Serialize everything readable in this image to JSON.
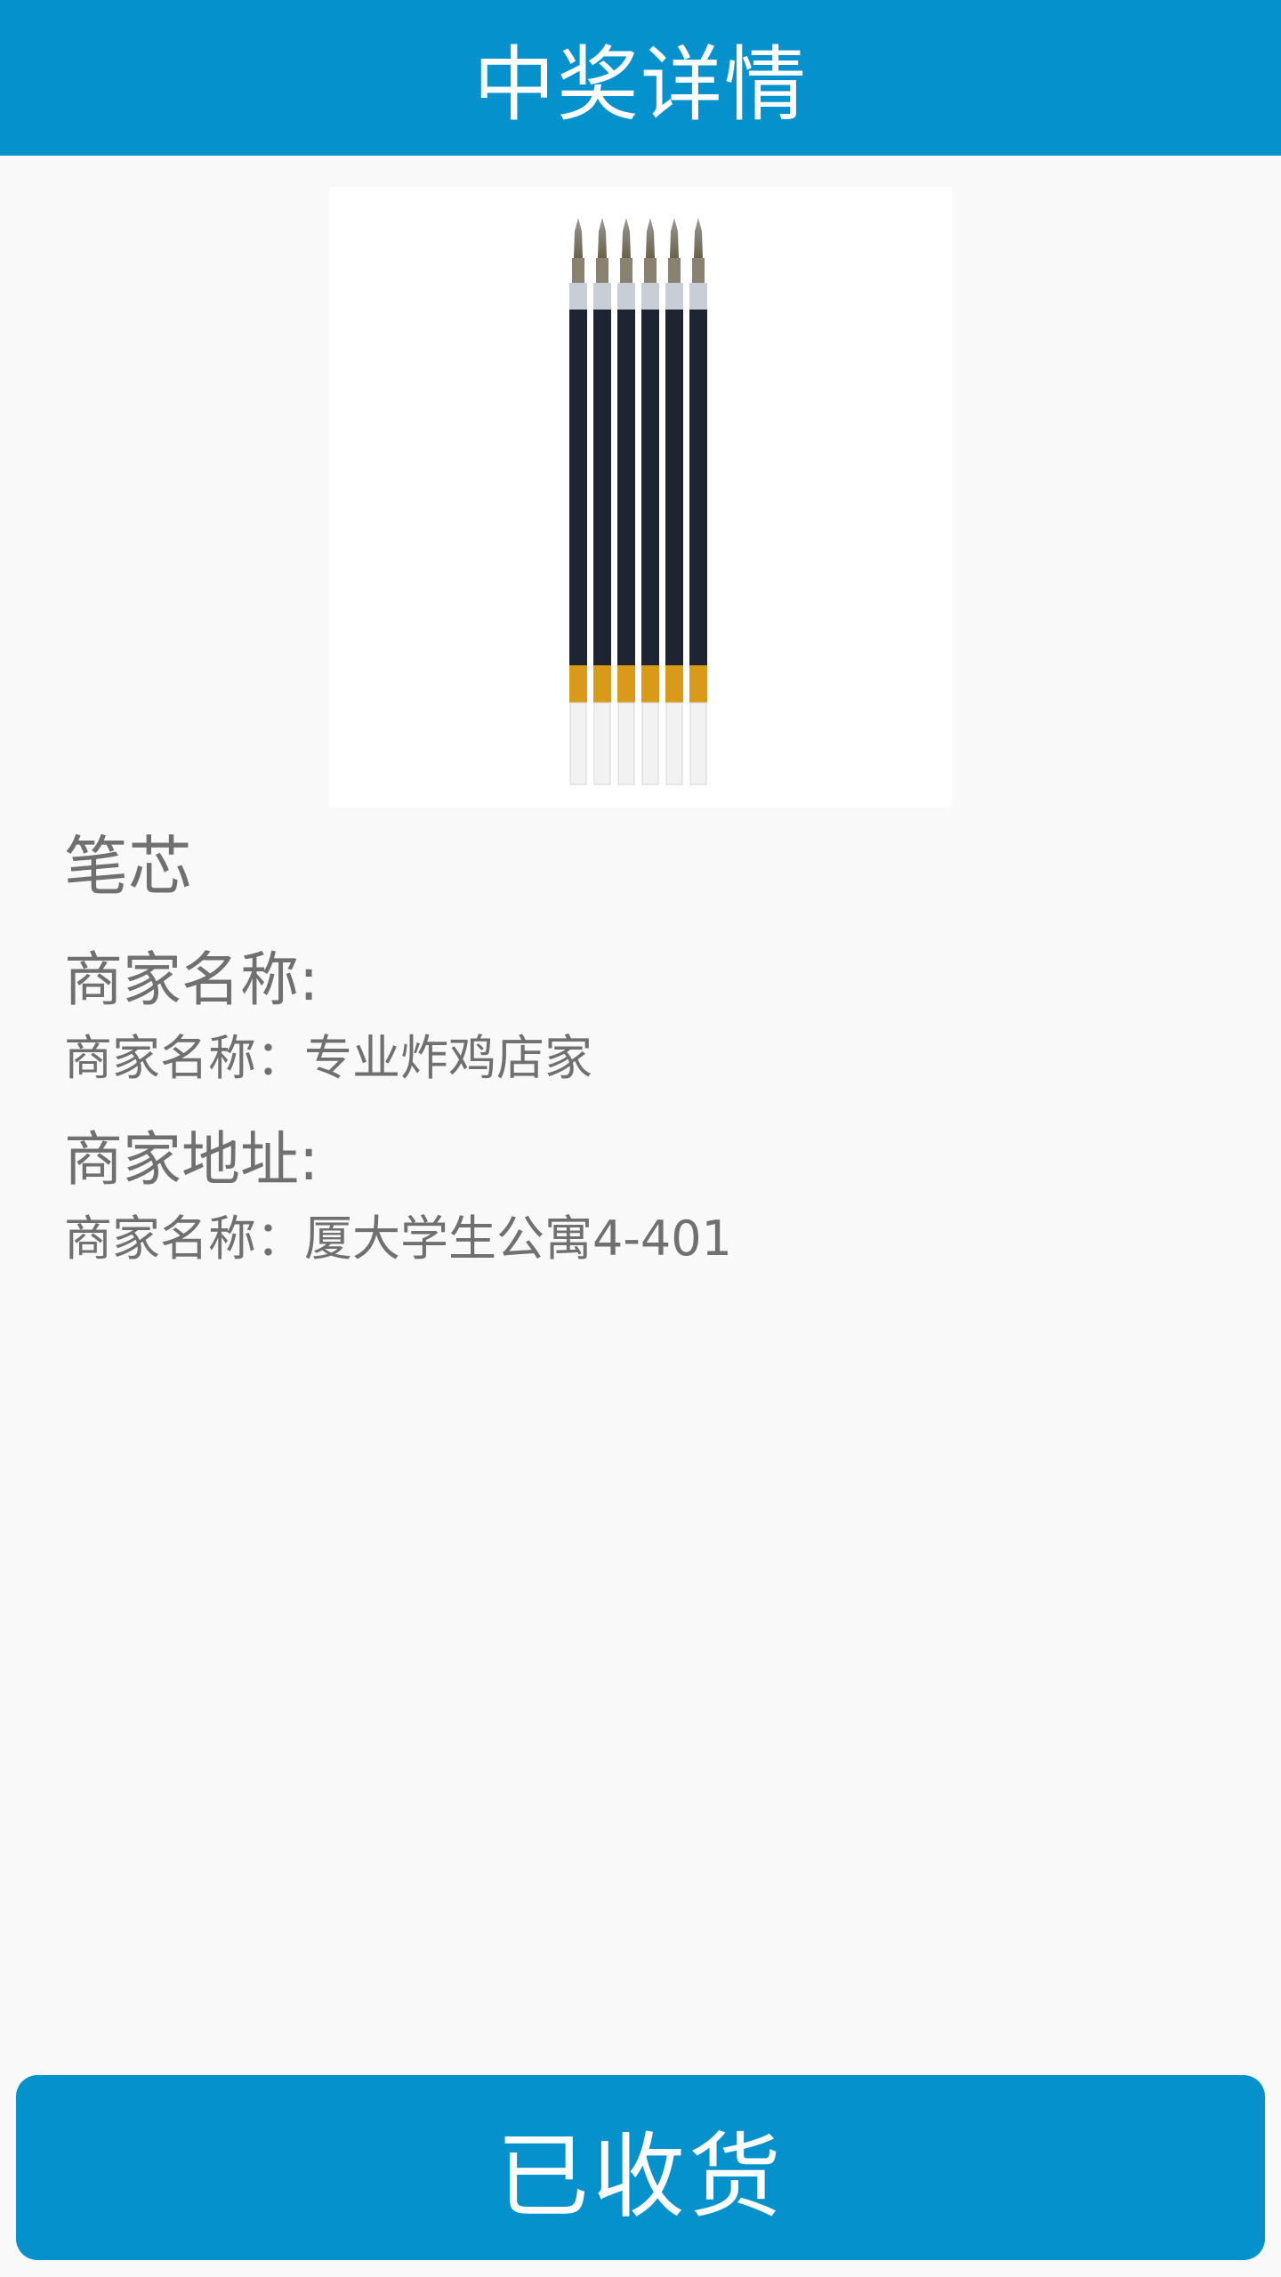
{
  "header": {
    "title": "中奖详情"
  },
  "product": {
    "image_icon": "pen-refills-image",
    "name": "笔芯"
  },
  "merchant_name": {
    "label": "商家名称:",
    "value": "商家名称：专业炸鸡店家"
  },
  "merchant_address": {
    "label": "商家地址:",
    "value": "商家名称：厦大学生公寓4-401"
  },
  "action": {
    "confirm_label": "已收货"
  },
  "colors": {
    "accent": "#0592cc",
    "background": "#f9f9f9",
    "text": "#707070"
  }
}
